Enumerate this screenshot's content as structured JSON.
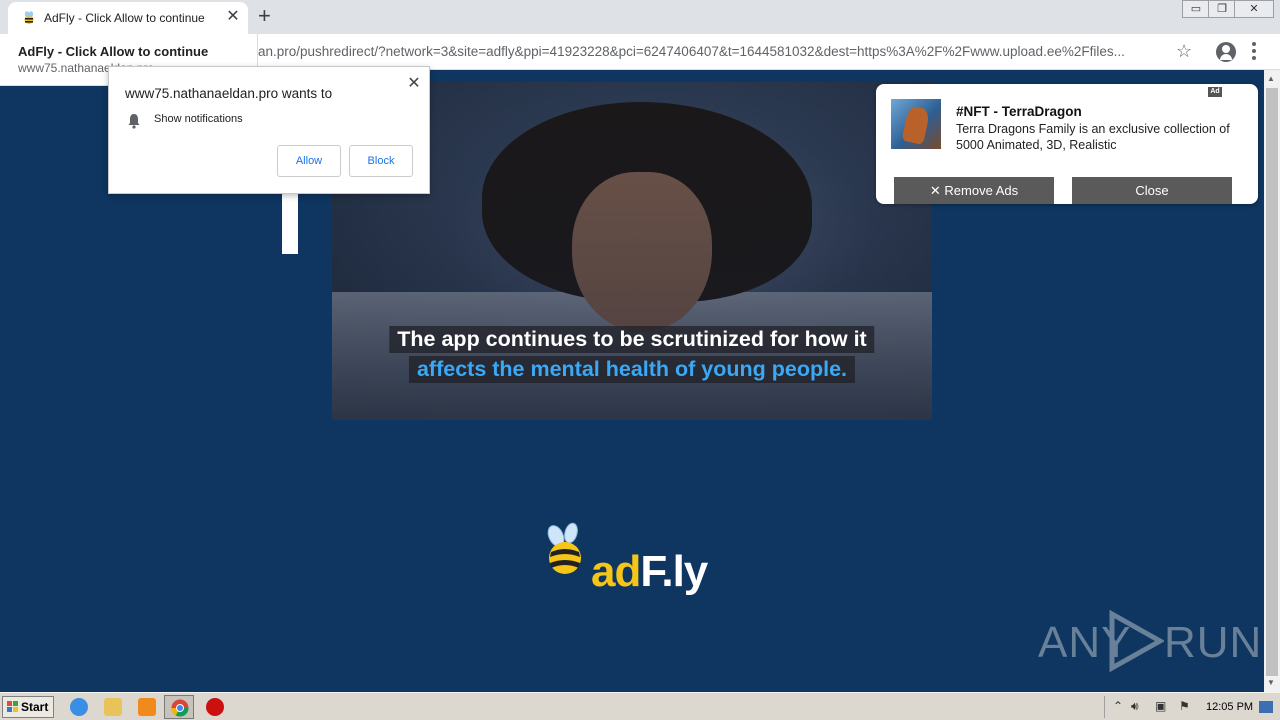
{
  "browser": {
    "tab_title": "AdFly - Click Allow to continue",
    "tab_close": "✕",
    "new_tab": "+",
    "url_visible": "an.pro/pushredirect/?network=3&site=adfly&ppi=41923228&pci=6247406407&t=1644581032&dest=https%3A%2F%2Fwww.upload.ee%2Ffiles...",
    "window_controls": [
      "▭",
      "❐",
      "✕"
    ]
  },
  "hovercard": {
    "title": "AdFly - Click Allow to continue",
    "url": "www75.nathanaeldan.pro"
  },
  "permission": {
    "title": "www75.nathanaeldan.pro wants to",
    "close": "✕",
    "request": "Show notifications",
    "allow": "Allow",
    "block": "Block"
  },
  "video": {
    "caption_line1": "The app continues to be scrutinized for how it",
    "caption_line2": "affects the mental health of young people."
  },
  "notification": {
    "badge": "Ad",
    "title": "#NFT - TerraDragon",
    "body": "Terra Dragons Family is an exclusive collection of 5000 Animated, 3D, Realistic",
    "remove_ads": "✕ Remove Ads",
    "close": "Close"
  },
  "logo": {
    "ad": "ad",
    "fly": "F.ly"
  },
  "watermark": {
    "any": "ANY",
    "run": "RUN"
  },
  "taskbar": {
    "start": "Start",
    "clock": "12:05 PM"
  },
  "colors": {
    "page_background": "#0e3660",
    "caption_accent": "#3aa8f5",
    "logo_yellow": "#f5c518",
    "link_blue": "#1a73e8"
  },
  "icons": [
    "adfly-favicon-icon",
    "star-icon",
    "account-icon",
    "menu-icon",
    "bell-icon",
    "windows-logo-icon",
    "ie-icon",
    "explorer-icon",
    "media-player-icon",
    "chrome-icon",
    "stop-icon",
    "volume-icon",
    "network-icon",
    "flag-icon"
  ]
}
